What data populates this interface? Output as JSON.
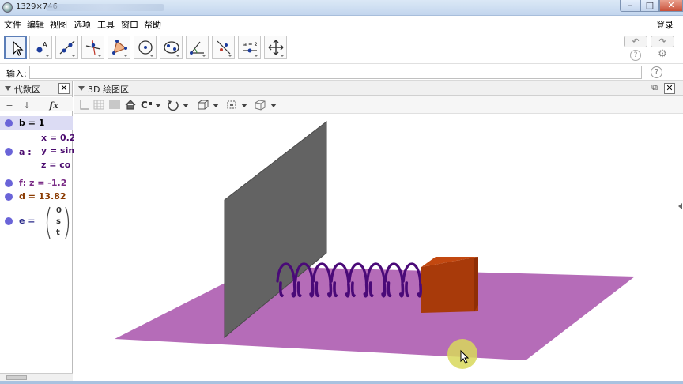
{
  "window": {
    "title": "1329×746",
    "close_glyph": "✕",
    "min_glyph": "–",
    "max_glyph": "□"
  },
  "menu": {
    "items": [
      "文件",
      "编辑",
      "视图",
      "选项",
      "工具",
      "窗口",
      "帮助"
    ],
    "login": "登录"
  },
  "toolbar": {
    "tools": [
      "move-tool-icon",
      "point-tool-icon",
      "line-tool-icon",
      "perpendicular-line-tool-icon",
      "polygon-tool-icon",
      "circle-tool-icon",
      "conic-tool-icon",
      "angle-tool-icon",
      "reflect-tool-icon",
      "slider-tool-icon",
      "move-view-tool-icon"
    ],
    "slider_label": "a = 2",
    "undo_glyph": "↶",
    "redo_glyph": "↷",
    "help_glyph": "?",
    "settings_glyph": "⚙"
  },
  "input": {
    "label": "输入:",
    "value": "",
    "help_glyph": "?"
  },
  "algebra": {
    "title": "代数区",
    "close_glyph": "✕",
    "toolbar_labels": [
      "≡",
      "↓",
      "fx"
    ],
    "rows": [
      {
        "text": "b = 1",
        "color": "#000000"
      },
      {
        "text": "a :",
        "color": "#4a0a6e",
        "lines": [
          "x = 0.2",
          "y = sin",
          "z = co"
        ]
      },
      {
        "text": "f: z = -1.2",
        "color": "#7a2c86"
      },
      {
        "text": "d = 13.82",
        "color": "#8a3a00"
      },
      {
        "text": "e =",
        "color": "#2a2a8a",
        "vector": [
          "0",
          "s",
          "t"
        ]
      }
    ]
  },
  "view3d": {
    "title": "3D 绘图区",
    "close_glyph": "✕",
    "undock_glyph": "⧉"
  },
  "colors": {
    "plane": "#b56cb8",
    "wall": "#636363",
    "wall_edge": "#4a4a4a",
    "spring": "#4a0a78",
    "cube_front": "#a83a0a",
    "cube_top": "#c24810",
    "cube_side": "#8f2e05",
    "cursor_highlight": "#d8d85a",
    "selection": "#dcdcf4",
    "dot": "#6a64d8"
  }
}
